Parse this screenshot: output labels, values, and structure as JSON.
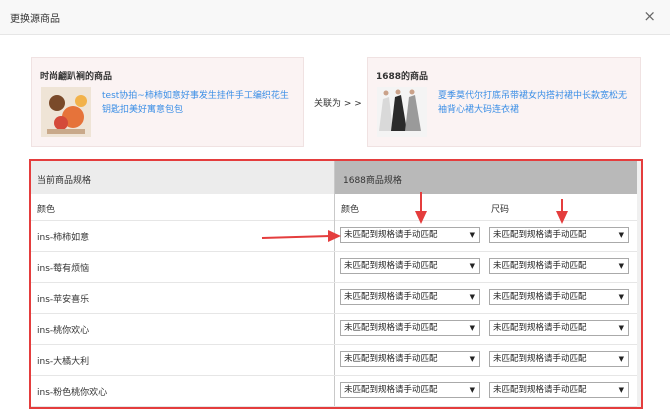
{
  "dialog": {
    "title": "更换源商品",
    "close": "×"
  },
  "current_product": {
    "box_title": "时尚翩趴裥的商品",
    "name": "test协拍~柿柿如意好事发生挂件手工编织花生钥匙扣美好寓意包包"
  },
  "association": "关联为 > >",
  "source_product": {
    "box_title": "1688的商品",
    "name": "夏季莫代尔打底吊带裙女内搭衬裙中长款宽松无袖背心裙大码连衣裙"
  },
  "table": {
    "left_header": "当前商品规格",
    "right_header": "1688商品规格",
    "left_sub": "颜色",
    "right_sub_color": "颜色",
    "right_sub_size": "尺码",
    "rows": [
      {
        "spec": "ins-柿柿如意",
        "color_value": "未匹配到规格请手动匹配",
        "size_value": "未匹配到规格请手动匹配"
      },
      {
        "spec": "ins-莓有烦恼",
        "color_value": "未匹配到规格请手动匹配",
        "size_value": "未匹配到规格请手动匹配"
      },
      {
        "spec": "ins-苹安喜乐",
        "color_value": "未匹配到规格请手动匹配",
        "size_value": "未匹配到规格请手动匹配"
      },
      {
        "spec": "ins-桃你欢心",
        "color_value": "未匹配到规格请手动匹配",
        "size_value": "未匹配到规格请手动匹配"
      },
      {
        "spec": "ins-大橘大利",
        "color_value": "未匹配到规格请手动匹配",
        "size_value": "未匹配到规格请手动匹配"
      },
      {
        "spec": "ins-粉色桃你欢心",
        "color_value": "未匹配到规格请手动匹配",
        "size_value": "未匹配到规格请手动匹配"
      }
    ]
  },
  "icons": {
    "dropdown": "chevron-down-icon",
    "close": "close-icon"
  },
  "colors": {
    "annotation_red": "#e43d3d",
    "link_blue": "#3a8ee6"
  }
}
